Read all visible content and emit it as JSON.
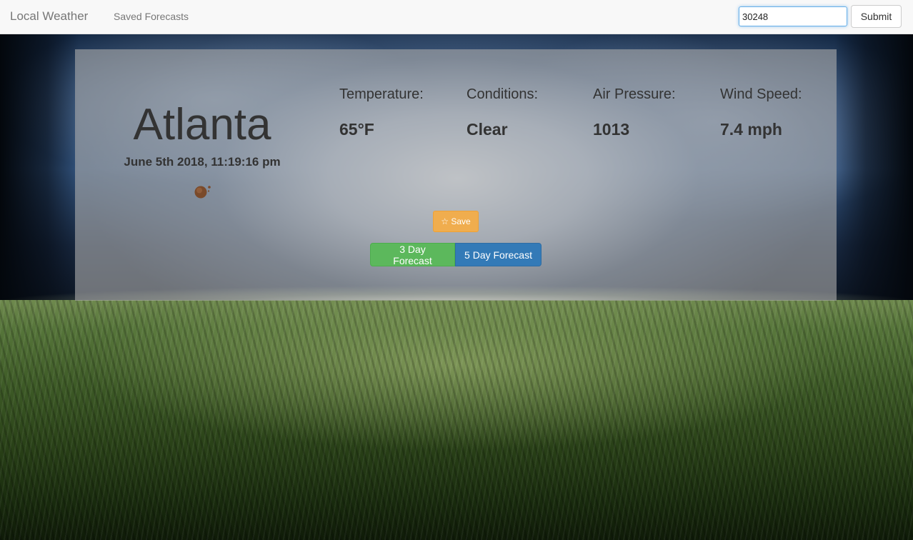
{
  "navbar": {
    "brand": "Local Weather",
    "saved_link": "Saved Forecasts",
    "zip_value": "30248",
    "submit_label": "Submit"
  },
  "weather": {
    "city": "Atlanta",
    "datetime": "June 5th 2018, 11:19:16 pm",
    "icon": "clear-night-moon-icon",
    "stats": [
      {
        "label": "Temperature:",
        "value": "65°F"
      },
      {
        "label": "Conditions:",
        "value": "Clear"
      },
      {
        "label": "Air Pressure:",
        "value": "1013"
      },
      {
        "label": "Wind Speed:",
        "value": "7.4 mph"
      }
    ]
  },
  "actions": {
    "save_label": "☆ Save",
    "three_day_label": "3 Day Forecast",
    "five_day_label": "5 Day Forecast"
  },
  "colors": {
    "save": "#f0ad4e",
    "three_day": "#5cb85c",
    "five_day": "#337ab7"
  }
}
